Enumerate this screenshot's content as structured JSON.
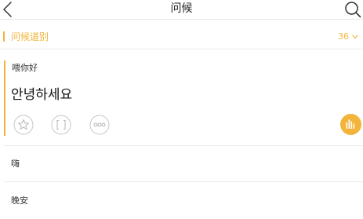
{
  "header": {
    "title": "问候",
    "back_icon": "chevron-left-icon",
    "search_icon": "search-icon"
  },
  "category": {
    "label": "问候道别",
    "count": "36",
    "accent_color": "#f2b43a"
  },
  "expanded_phrase": {
    "chinese": "喂你好",
    "korean": "안녕하세요",
    "actions": [
      "star-icon",
      "expand-icon",
      "more-icon",
      "audio-play-icon"
    ]
  },
  "phrases": [
    {
      "chinese": "嗨"
    },
    {
      "chinese": "晚安"
    }
  ]
}
